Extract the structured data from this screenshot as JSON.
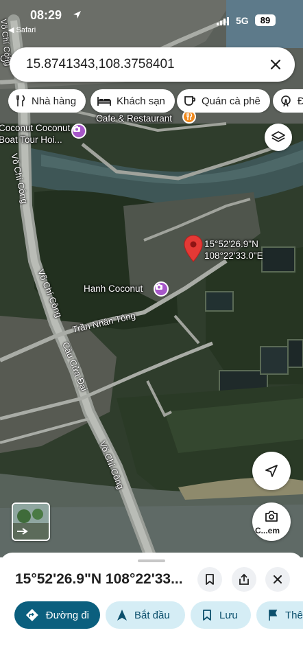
{
  "status_bar": {
    "time": "08:29",
    "back_app": "◀ Safari",
    "network": "5G",
    "battery": "89"
  },
  "search": {
    "query": "15.8741343,108.3758401"
  },
  "chips": [
    {
      "label": "Nhà hàng",
      "icon": "fork-knife-icon"
    },
    {
      "label": "Khách sạn",
      "icon": "bed-icon"
    },
    {
      "label": "Quán cà phê",
      "icon": "coffee-cup-icon"
    },
    {
      "label": "Đ",
      "icon": "ferris-wheel-icon"
    }
  ],
  "map": {
    "places": {
      "coconut_boat_tour": "Coconut Coconut\nBoat Tour Hoi...",
      "cafe_restaurant": "Cafe & Restaurant",
      "hanh_coconut": "Hanh Coconut",
      "top_left_fragment": "Co"
    },
    "roads": {
      "vo_chi_cong": "Võ Chí Công",
      "tran_nhan_tong": "Trần Nhân Tông",
      "cau_cua_dai": "Cầu Cửa Đại"
    },
    "pin": {
      "lat_dms": "15°52'26.9\"N",
      "lng_dms": "108°22'33.0\"E",
      "color": "#e53935"
    },
    "lens_label": "C...em"
  },
  "sheet": {
    "title": "15°52'26.9\"N 108°22'33...",
    "actions": [
      {
        "label": "Đường đi",
        "icon": "directions-icon",
        "style": "primary"
      },
      {
        "label": "Bắt đầu",
        "icon": "navigation-arrow-icon",
        "style": "secondary"
      },
      {
        "label": "Lưu",
        "icon": "bookmark-icon",
        "style": "secondary"
      },
      {
        "label": "Thê",
        "icon": "flag-icon",
        "style": "secondary"
      }
    ]
  },
  "colors": {
    "primary_action": "#0b5f7e",
    "secondary_action": "#d5edf5",
    "poi_purple": "#a757c9"
  }
}
